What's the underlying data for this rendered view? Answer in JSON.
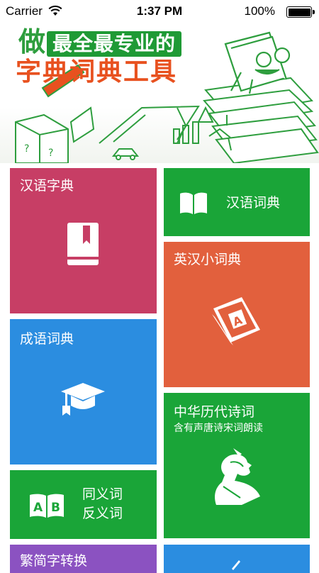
{
  "status_bar": {
    "carrier": "Carrier",
    "time": "1:37 PM",
    "battery_percent": 100
  },
  "banner": {
    "line1_prefix": "做",
    "line1": "最全最专业的",
    "line2": "字典词典工具"
  },
  "tiles": {
    "zidian": {
      "label": "汉语字典",
      "color": "#c73e65",
      "icon": "book-bookmark-icon"
    },
    "cidian": {
      "label": "汉语词典",
      "color": "#1aa538",
      "icon": "open-book-icon"
    },
    "yinghan": {
      "label": "英汉小词典",
      "color": "#e2603d",
      "icon": "english-dictionary-icon"
    },
    "chengyu": {
      "label": "成语词典",
      "color": "#2b8de0",
      "icon": "graduation-cap-icon"
    },
    "shici": {
      "label": "中华历代诗词",
      "subtitle": "含有声唐诗宋词朗读",
      "color": "#1aa538",
      "icon": "poet-silhouette-icon"
    },
    "tongyi": {
      "label_line1": "同义词",
      "label_line2": "反义词",
      "color": "#1aa538",
      "icon": "ab-book-icon"
    },
    "bottom_left": {
      "label": "繁简字转换",
      "color": "#8b52c1"
    },
    "bottom_right": {
      "color": "#2b8de0"
    }
  }
}
